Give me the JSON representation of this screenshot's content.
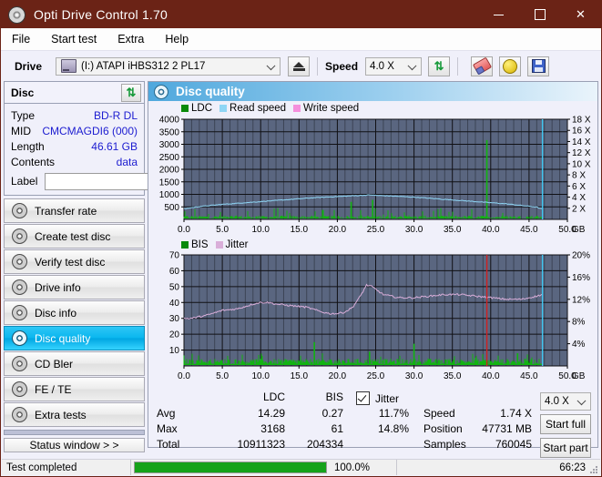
{
  "window": {
    "title": "Opti Drive Control 1.70",
    "icon": "disc-icon",
    "minimize": "—",
    "maximize": "□",
    "close": "✕"
  },
  "menu": {
    "items": [
      "File",
      "Start test",
      "Extra",
      "Help"
    ]
  },
  "toolbar": {
    "drive_label": "Drive",
    "drive_value": "(I:)   ATAPI iHBS312   2 PL17",
    "eject_icon": "eject-icon",
    "speed_label": "Speed",
    "speed_value": "4.0 X",
    "refresh_icon": "refresh-icon",
    "eraser_icon": "eraser-icon",
    "bulb_icon": "bulb-icon",
    "save_icon": "save-icon"
  },
  "disc": {
    "header": "Disc",
    "refresh_icon": "refresh-icon",
    "rows": [
      {
        "key": "Type",
        "value": "BD-R DL"
      },
      {
        "key": "MID",
        "value": "CMCMAGDI6 (000)"
      },
      {
        "key": "Length",
        "value": "46.61 GB"
      },
      {
        "key": "Contents",
        "value": "data"
      }
    ],
    "label_key": "Label",
    "label_value": "",
    "label_placeholder": "",
    "label_button_icon": "cd-icon"
  },
  "sidebar": {
    "items": [
      {
        "label": "Transfer rate",
        "icon": "disc-icon",
        "active": false
      },
      {
        "label": "Create test disc",
        "icon": "disc-icon",
        "active": false
      },
      {
        "label": "Verify test disc",
        "icon": "disc-icon",
        "active": false
      },
      {
        "label": "Drive info",
        "icon": "disc-icon",
        "active": false
      },
      {
        "label": "Disc info",
        "icon": "disc-icon",
        "active": false
      },
      {
        "label": "Disc quality",
        "icon": "disc-icon",
        "active": true
      },
      {
        "label": "CD Bler",
        "icon": "disc-icon",
        "active": false
      },
      {
        "label": "FE / TE",
        "icon": "disc-icon",
        "active": false
      },
      {
        "label": "Extra tests",
        "icon": "disc-icon",
        "active": false
      }
    ],
    "status_window": "Status window > >"
  },
  "main": {
    "title": "Disc quality",
    "icon": "disc-quality-icon"
  },
  "results": {
    "columns": [
      "LDC",
      "BIS"
    ],
    "rows": [
      {
        "label": "Avg",
        "ldc": "14.29",
        "bis": "0.27",
        "jitter": "11.7%"
      },
      {
        "label": "Max",
        "ldc": "3168",
        "bis": "61",
        "jitter": "14.8%"
      },
      {
        "label": "Total",
        "ldc": "10911323",
        "bis": "204334",
        "jitter": ""
      }
    ],
    "jitter_label": "Jitter",
    "jitter_checked": true,
    "speed_label": "Speed",
    "speed_value": "1.74 X",
    "position_label": "Position",
    "position_value": "47731 MB",
    "samples_label": "Samples",
    "samples_value": "760045",
    "speed_select": "4.0 X",
    "start_full": "Start full",
    "start_part": "Start part"
  },
  "statusbar": {
    "message": "Test completed",
    "progress_text": "100.0%",
    "progress_percent": 100,
    "elapsed": "66:23"
  },
  "colors": {
    "title_bar": "#6b2316",
    "accent": "#00a6e2",
    "plot_bg": "#5a6680",
    "ldc_green": "#11b411",
    "read_speed": "#8fd6f5",
    "write_speed": "#f58fdc",
    "jitter_pink": "#d9aed9",
    "value_blue": "#1c1cd0",
    "progress_green": "#16a21a"
  },
  "chart_data": [
    {
      "type": "line",
      "title": "LDC / Read speed",
      "legend": [
        {
          "name": "LDC",
          "color": "#0a8a0a"
        },
        {
          "name": "Read speed",
          "color": "#8fd6f5"
        },
        {
          "name": "Write speed",
          "color": "#f58fdc"
        }
      ],
      "legend_position": "top-left",
      "xlabel": "GB",
      "x_ticks": [
        "0.0",
        "5.0",
        "10.0",
        "15.0",
        "20.0",
        "25.0",
        "30.0",
        "35.0",
        "40.0",
        "45.0",
        "50.0"
      ],
      "xlim": [
        0,
        50
      ],
      "ylabel_left": "LDC",
      "y_ticks_left": [
        "500",
        "1000",
        "1500",
        "2000",
        "2500",
        "3000",
        "3500",
        "4000"
      ],
      "ylim_left": [
        0,
        4000
      ],
      "ylabel_right": "Speed",
      "y_ticks_right": [
        "2 X",
        "4 X",
        "6 X",
        "8 X",
        "10 X",
        "12 X",
        "14 X",
        "16 X",
        "18 X"
      ],
      "ylim_right": [
        0,
        18
      ],
      "grid": true,
      "series": [
        {
          "name": "Read speed",
          "color": "#8fd6f5",
          "x": [
            0,
            2,
            5,
            8,
            11,
            14,
            17,
            20,
            23,
            24.5,
            25,
            27,
            30,
            33,
            36,
            39,
            42,
            44,
            46,
            46.6
          ],
          "values": [
            1.9,
            2.3,
            2.7,
            3.0,
            3.3,
            3.6,
            3.9,
            4.1,
            4.3,
            4.4,
            4.3,
            4.2,
            4.0,
            3.7,
            3.4,
            3.1,
            2.8,
            2.5,
            2.2,
            1.9
          ]
        },
        {
          "name": "LDC",
          "color": "#11b411",
          "note": "dense noise band, baseline ~40, typical peaks 150-450, one spike to 3168 at ~39.5 GB",
          "baseline": 40,
          "typical_peak": 350,
          "max_spike": {
            "x": 39.5,
            "y": 3168
          }
        }
      ],
      "markers": [
        {
          "name": "end-of-data-cursor",
          "color": "#3fc6f0",
          "x": 46.7
        }
      ]
    },
    {
      "type": "line",
      "title": "BIS / Jitter",
      "legend": [
        {
          "name": "BIS",
          "color": "#0a8a0a"
        },
        {
          "name": "Jitter",
          "color": "#d9aed9"
        }
      ],
      "legend_position": "top-left",
      "xlabel": "GB",
      "x_ticks": [
        "0.0",
        "5.0",
        "10.0",
        "15.0",
        "20.0",
        "25.0",
        "30.0",
        "35.0",
        "40.0",
        "45.0",
        "50.0"
      ],
      "xlim": [
        0,
        50
      ],
      "ylabel_left": "BIS",
      "y_ticks_left": [
        "10",
        "20",
        "30",
        "40",
        "50",
        "60",
        "70"
      ],
      "ylim_left": [
        0,
        70
      ],
      "ylabel_right": "Jitter",
      "y_ticks_right": [
        "4%",
        "8%",
        "12%",
        "16%",
        "20%"
      ],
      "ylim_right": [
        0,
        20
      ],
      "grid": true,
      "series": [
        {
          "name": "Jitter",
          "color": "#d9aed9",
          "x": [
            0,
            1,
            3,
            5,
            7,
            9,
            10,
            11,
            12,
            14,
            16,
            18,
            19,
            20,
            21,
            22,
            23,
            23.8,
            24.5,
            26,
            28,
            30,
            32,
            34,
            36,
            38,
            40,
            42,
            44,
            45,
            46,
            46.7
          ],
          "values": [
            30,
            30,
            32,
            35,
            36,
            39,
            40,
            40,
            39,
            38,
            37,
            34,
            33,
            33,
            34,
            37,
            44,
            51,
            50,
            45,
            43,
            43,
            44,
            45,
            45,
            44,
            43,
            42,
            42,
            43,
            44,
            45
          ],
          "units": "axis-left-units (scale 0-70 maps to 0-20%)"
        },
        {
          "name": "BIS",
          "color": "#11b411",
          "note": "dense noise band, baseline ~1, typical peaks 3-6, local spikes to 15 at ~17 GB and ~30 GB",
          "baseline": 1,
          "typical_peak": 5,
          "max_spike": {
            "x": 17,
            "y": 15
          }
        }
      ],
      "markers": [
        {
          "name": "avg-position-cursor",
          "color": "#d02020",
          "x": 39.5
        },
        {
          "name": "end-of-data-cursor",
          "color": "#3fc6f0",
          "x": 46.7
        }
      ]
    }
  ]
}
